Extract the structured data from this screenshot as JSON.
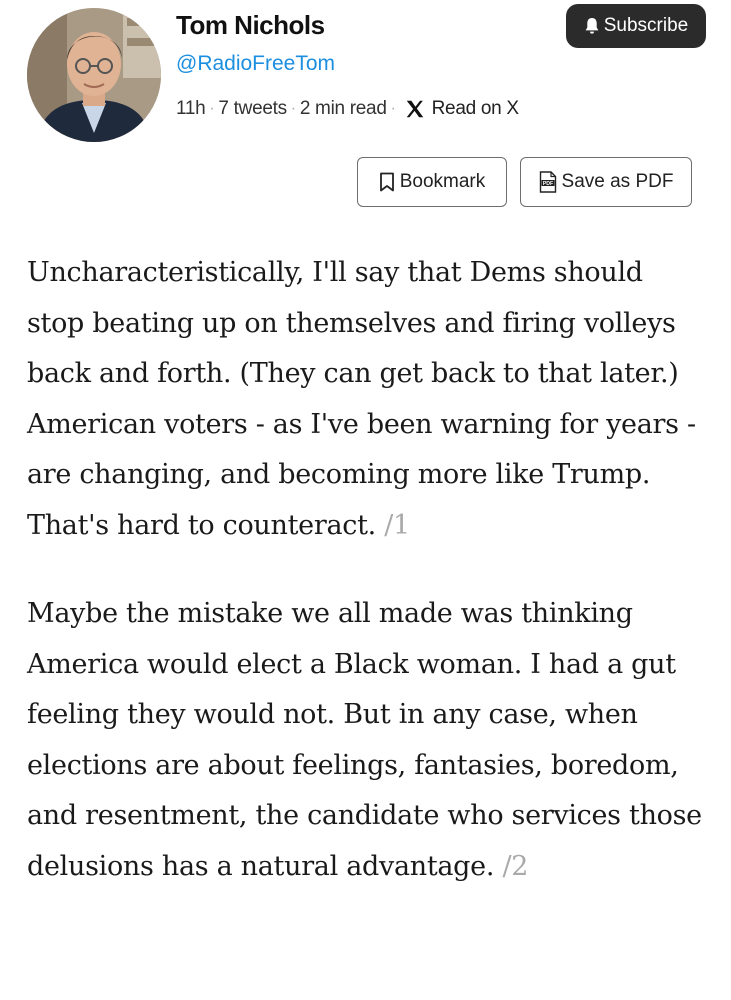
{
  "profile": {
    "name": "Tom Nichols",
    "handle": "@RadioFreeTom",
    "time_ago": "11h",
    "tweet_count": "7 tweets",
    "read_time": "2 min read",
    "read_on_x": "Read on X"
  },
  "actions": {
    "subscribe_label": "Subscribe",
    "bookmark_label": "Bookmark",
    "pdf_label": "Save as PDF"
  },
  "tweets": [
    {
      "text": "Uncharacteristically, I'll say that Dems should stop beating up on themselves and firing volleys back and forth. (They can get back to that later.) American voters - as I've been warning for years - are changing, and becoming more like Trump. That's hard to counteract.",
      "number": "/1"
    },
    {
      "text": "Maybe the mistake we all made was thinking America would elect a Black woman. I had a gut feeling they would not. But in any case, when elections are about feelings, fantasies, boredom, and resentment, the candidate who services those delusions has a natural advantage.",
      "number": "/2"
    }
  ],
  "icons": {
    "subscribe": "bell-icon",
    "bookmark": "bookmark-icon",
    "pdf": "pdf-icon",
    "x": "x-logo-icon"
  },
  "colors": {
    "handle": "#1d8fe0",
    "subscribe_bg": "#2b2b2b",
    "tweet_number": "#a9a9a9"
  }
}
